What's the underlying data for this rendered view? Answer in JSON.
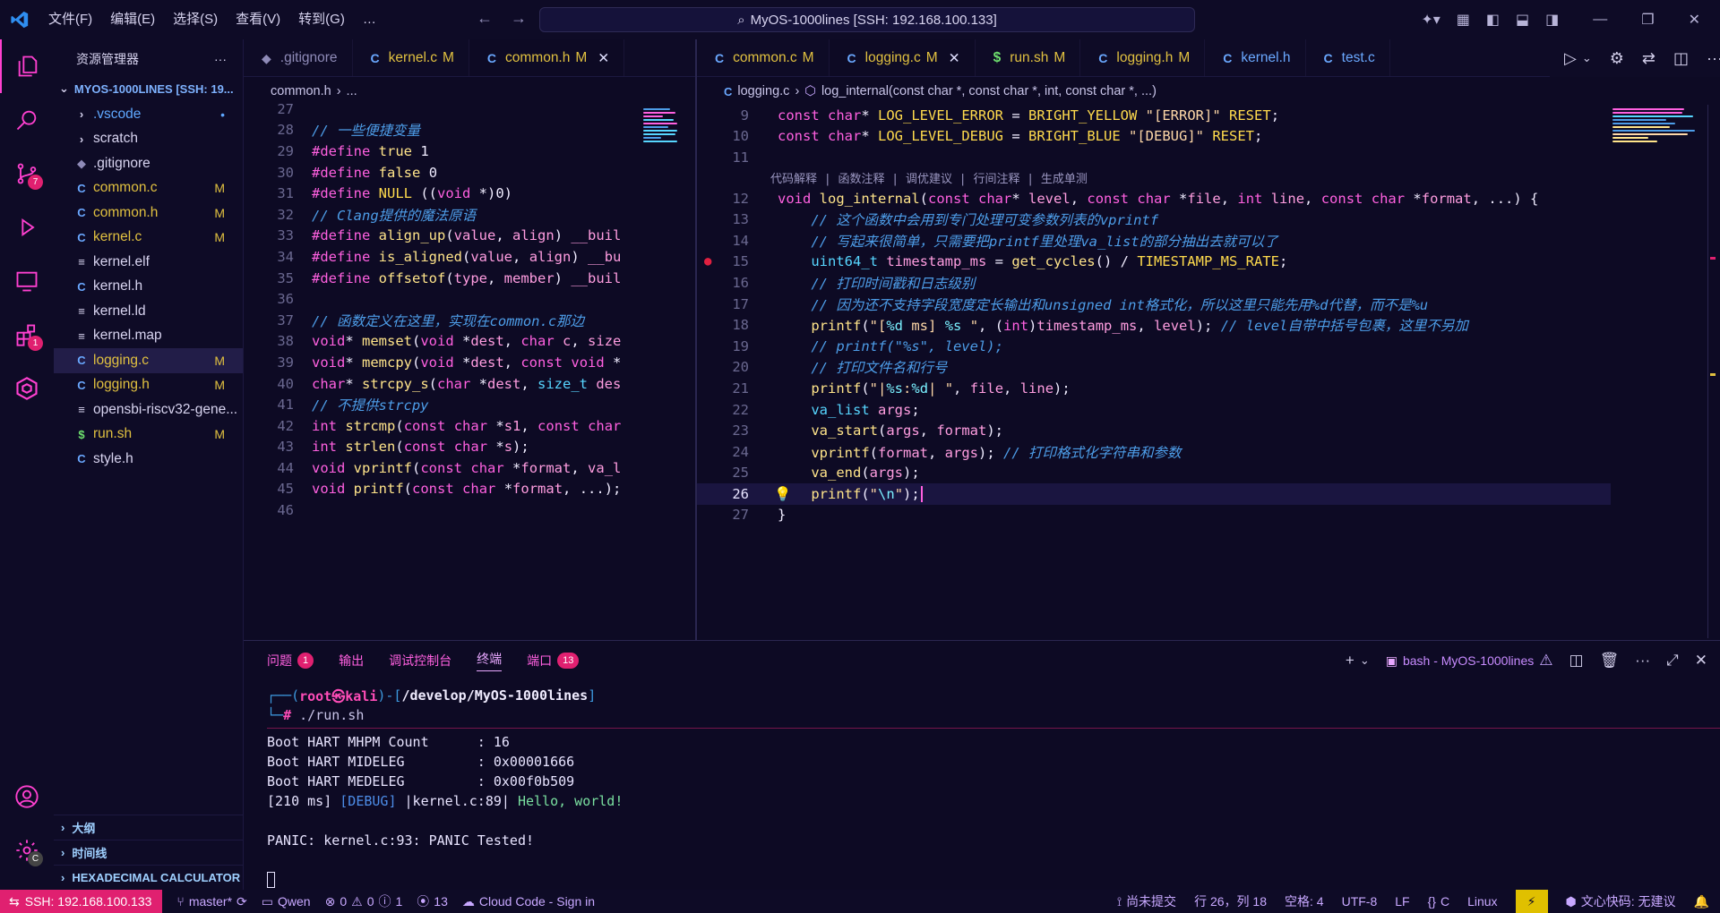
{
  "titlebar": {
    "menu": [
      "文件(F)",
      "编辑(E)",
      "选择(S)",
      "查看(V)",
      "转到(G)",
      "…"
    ],
    "search_text": "MyOS-1000lines [SSH: 192.168.100.133]"
  },
  "activity": {
    "scm_badge": "7",
    "ext_badge": "1",
    "settings_badge": "C"
  },
  "sidebar": {
    "title": "资源管理器",
    "root": "MYOS-1000LINES [SSH: 19...",
    "items": [
      {
        "label": ".vscode",
        "kind": "folder",
        "color": "#5fa8ff",
        "mark": "•"
      },
      {
        "label": "scratch",
        "kind": "folder",
        "color": "#d8d4f0",
        "mark": ""
      },
      {
        "label": ".gitignore",
        "kind": "git",
        "color": "#d8d4f0",
        "mark": ""
      },
      {
        "label": "common.c",
        "kind": "c",
        "color": "#e0c040",
        "mark": "M"
      },
      {
        "label": "common.h",
        "kind": "c",
        "color": "#e0c040",
        "mark": "M"
      },
      {
        "label": "kernel.c",
        "kind": "c",
        "color": "#e0c040",
        "mark": "M"
      },
      {
        "label": "kernel.elf",
        "kind": "file",
        "color": "#d8d4f0",
        "mark": ""
      },
      {
        "label": "kernel.h",
        "kind": "c",
        "color": "#d8d4f0",
        "mark": ""
      },
      {
        "label": "kernel.ld",
        "kind": "file",
        "color": "#d8d4f0",
        "mark": ""
      },
      {
        "label": "kernel.map",
        "kind": "file",
        "color": "#d8d4f0",
        "mark": ""
      },
      {
        "label": "logging.c",
        "kind": "c",
        "color": "#e0c040",
        "mark": "M"
      },
      {
        "label": "logging.h",
        "kind": "c",
        "color": "#e0c040",
        "mark": "M"
      },
      {
        "label": "opensbi-riscv32-gene...",
        "kind": "file",
        "color": "#d8d4f0",
        "mark": ""
      },
      {
        "label": "run.sh",
        "kind": "sh",
        "color": "#e0c040",
        "mark": "M"
      },
      {
        "label": "style.h",
        "kind": "c",
        "color": "#d8d4f0",
        "mark": ""
      }
    ],
    "sections": [
      "大纲",
      "时间线",
      "HEXADECIMAL CALCULATOR"
    ]
  },
  "left_editor": {
    "tabs": [
      {
        "label": ".gitignore",
        "mark": ""
      },
      {
        "label": "kernel.c",
        "mark": "M"
      },
      {
        "label": "common.h",
        "mark": "M",
        "active": true
      }
    ],
    "breadcrumb": [
      "common.h",
      "..."
    ],
    "first_line": 27,
    "lines": [
      {
        "n": "27",
        "t": ""
      },
      {
        "n": "28",
        "t": "// 一些便捷变量",
        "cls": "cm"
      },
      {
        "n": "29",
        "t": "#define true 1"
      },
      {
        "n": "30",
        "t": "#define false 0"
      },
      {
        "n": "31",
        "t": "#define NULL ((void *)0)"
      },
      {
        "n": "32",
        "t": "// Clang提供的魔法原语",
        "cls": "cm"
      },
      {
        "n": "33",
        "t": "#define align_up(value, align) __buil"
      },
      {
        "n": "34",
        "t": "#define is_aligned(value, align) __bu"
      },
      {
        "n": "35",
        "t": "#define offsetof(type, member) __buil"
      },
      {
        "n": "36",
        "t": ""
      },
      {
        "n": "37",
        "t": "// 函数定义在这里，实现在common.c那边",
        "cls": "cm"
      },
      {
        "n": "38",
        "t": "void* memset(void *dest, char c, size"
      },
      {
        "n": "39",
        "t": "void* memcpy(void *dest, const void *"
      },
      {
        "n": "40",
        "t": "char* strcpy_s(char *dest, size_t des"
      },
      {
        "n": "41",
        "t": "// 不提供strcpy",
        "cls": "cm"
      },
      {
        "n": "42",
        "t": "int strcmp(const char *s1, const char"
      },
      {
        "n": "43",
        "t": "int strlen(const char *s);"
      },
      {
        "n": "44",
        "t": "void vprintf(const char *format, va_l"
      },
      {
        "n": "45",
        "t": "void printf(const char *format, ...);"
      },
      {
        "n": "46",
        "t": ""
      }
    ]
  },
  "right_editor": {
    "tabs": [
      {
        "label": "common.c",
        "mark": "M",
        "kind": "c"
      },
      {
        "label": "logging.c",
        "mark": "M",
        "kind": "c",
        "active": true
      },
      {
        "label": "run.sh",
        "mark": "M",
        "kind": "sh"
      },
      {
        "label": "logging.h",
        "mark": "M",
        "kind": "c"
      },
      {
        "label": "kernel.h",
        "mark": "",
        "kind": "c"
      },
      {
        "label": "test.c",
        "mark": "",
        "kind": "c"
      }
    ],
    "breadcrumb_file": "logging.c",
    "breadcrumb_fn": "log_internal(const char *, const char *, int, const char *, ...)",
    "codelens": "代码解释 | 函数注释 | 调优建议 | 行间注释 | 生成单测",
    "lines": [
      {
        "n": "9",
        "t": "const char* LOG_LEVEL_ERROR = BRIGHT_YELLOW \"[ERROR]\" RESET;"
      },
      {
        "n": "10",
        "t": "const char* LOG_LEVEL_DEBUG = BRIGHT_BLUE \"[DEBUG]\" RESET;"
      },
      {
        "n": "11",
        "t": ""
      },
      {
        "n": "12",
        "t": "void log_internal(const char* level, const char *file, int line, const char *format, ...) {"
      },
      {
        "n": "13",
        "t": "    // 这个函数中会用到专门处理可变参数列表的vprintf"
      },
      {
        "n": "14",
        "t": "    // 写起来很简单，只需要把printf里处理va_list的部分抽出去就可以了"
      },
      {
        "n": "15",
        "t": "    uint64_t timestamp_ms = get_cycles() / TIMESTAMP_MS_RATE;"
      },
      {
        "n": "16",
        "t": "    // 打印时间戳和日志级别"
      },
      {
        "n": "17",
        "t": "    // 因为还不支持字段宽度定长输出和unsigned int格式化，所以这里只能先用%d代替，而不是%u"
      },
      {
        "n": "18",
        "t": "    printf(\"[%d ms] %s \", (int)timestamp_ms, level); // level自带中括号包裹，这里不另加"
      },
      {
        "n": "19",
        "t": "    // printf(\"%s\", level);"
      },
      {
        "n": "20",
        "t": "    // 打印文件名和行号"
      },
      {
        "n": "21",
        "t": "    printf(\"|%s:%d| \", file, line);"
      },
      {
        "n": "22",
        "t": "    va_list args;"
      },
      {
        "n": "23",
        "t": "    va_start(args, format);"
      },
      {
        "n": "24",
        "t": "    vprintf(format, args); // 打印格式化字符串和参数"
      },
      {
        "n": "25",
        "t": "    va_end(args);"
      },
      {
        "n": "26",
        "t": "    printf(\"\\n\");"
      },
      {
        "n": "27",
        "t": "}"
      }
    ]
  },
  "panel": {
    "tabs": [
      {
        "label": "问题",
        "badge": "1"
      },
      {
        "label": "输出",
        "badge": ""
      },
      {
        "label": "调试控制台",
        "badge": ""
      },
      {
        "label": "终端",
        "badge": "",
        "active": true
      },
      {
        "label": "端口",
        "badge": "13"
      }
    ],
    "terminal_name": "bash - MyOS-1000lines",
    "prompt_user": "root㉿kali",
    "prompt_path": "/develop/MyOS-1000lines",
    "command": "./run.sh",
    "output": [
      "Boot HART MHPM Count      : 16",
      "Boot HART MIDELEG         : 0x00001666",
      "Boot HART MEDELEG         : 0x00f0b509"
    ],
    "log_ts": "[210 ms]",
    "log_level": "[DEBUG]",
    "log_loc": "|kernel.c:89|",
    "log_msg": "Hello, world!",
    "panic": "PANIC: kernel.c:93: PANIC Tested!"
  },
  "status": {
    "ssh": "SSH: 192.168.100.133",
    "branch": "master*",
    "qwen": "Qwen",
    "errors": "0",
    "warnings": "0",
    "infos": "1",
    "ports": "13",
    "cloud": "Cloud Code - Sign in",
    "uncommitted": "尚未提交",
    "position": "行 26，列 18",
    "spaces": "空格: 4",
    "encoding": "UTF-8",
    "eol": "LF",
    "lang": "C",
    "os": "Linux",
    "wenxin": "文心快码: 无建议"
  }
}
